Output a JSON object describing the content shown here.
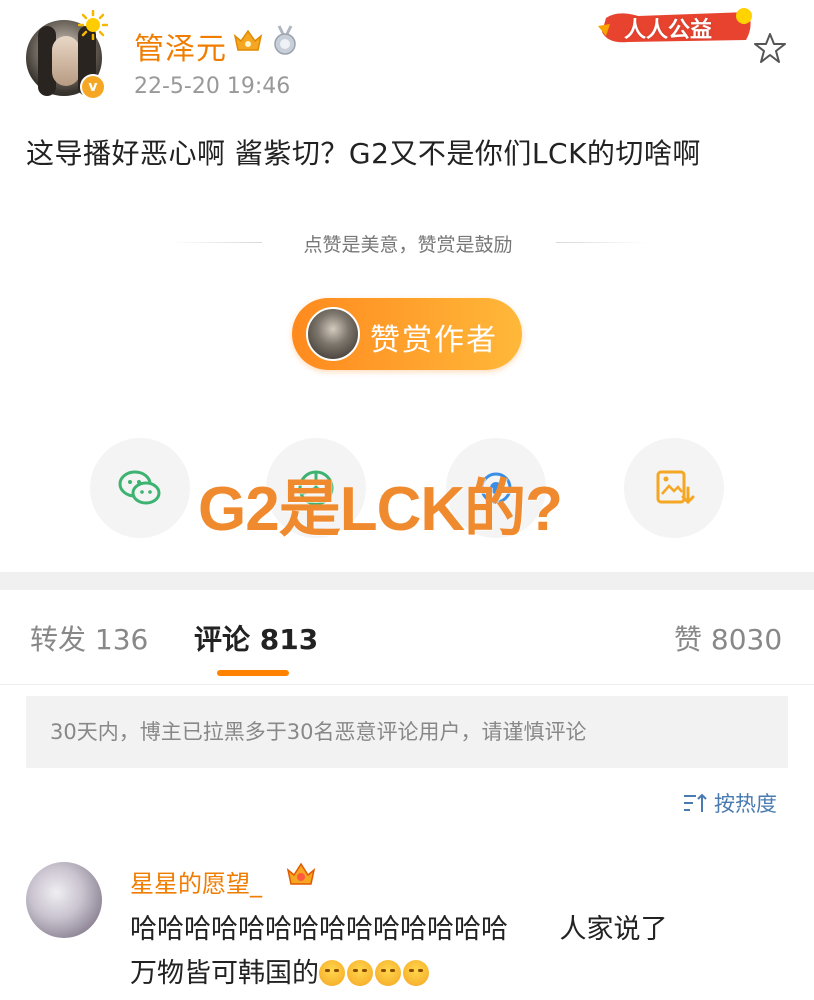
{
  "post": {
    "username": "管泽元",
    "timestamp": "22-5-20 19:46",
    "charity_badge": "人人公益",
    "text": "这导播好恶心啊 酱紫切？G2又不是你们LCK的切啥啊"
  },
  "reward": {
    "slogan": "点赞是美意，赞赏是鼓励",
    "button_label": "赞赏作者"
  },
  "share": {
    "icons": [
      "wechat-icon",
      "moments-icon",
      "weibo-icon",
      "save-image-icon"
    ]
  },
  "overlay_caption": "G2是LCK的?",
  "tabs": [
    {
      "label": "转发",
      "count": "136"
    },
    {
      "label": "评论",
      "count": "813"
    },
    {
      "label": "赞",
      "count": "8030"
    }
  ],
  "notice": "30天内，博主已拉黑多于30名恶意评论用户，请谨慎评论",
  "sort_label": "按热度",
  "comment": {
    "username": "星星的愿望_",
    "text_line1": "哈哈哈哈哈哈哈哈哈哈哈哈哈哈      人家说了",
    "text_line2": "万物皆可韩国的"
  },
  "colors": {
    "brand_orange": "#ff8200",
    "username_orange": "#f07d00",
    "link_blue": "#4a7bb0"
  }
}
